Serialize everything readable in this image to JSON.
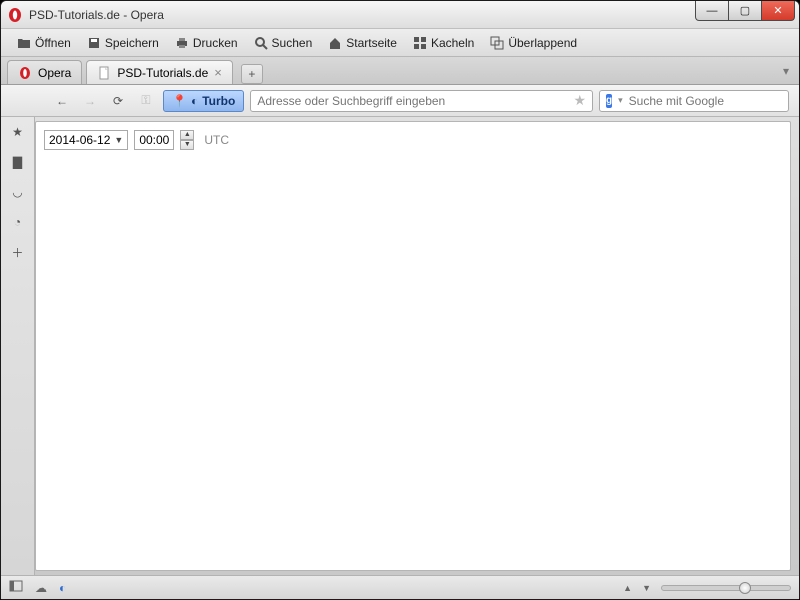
{
  "window": {
    "title": "PSD-Tutorials.de - Opera"
  },
  "menu": {
    "open": "Öffnen",
    "save": "Speichern",
    "print": "Drucken",
    "search": "Suchen",
    "home": "Startseite",
    "tile": "Kacheln",
    "cascade": "Überlappend"
  },
  "tabs": {
    "opera": "Opera",
    "active": "PSD-Tutorials.de"
  },
  "nav": {
    "turbo": "Turbo",
    "address_placeholder": "Adresse oder Suchbegriff eingeben",
    "search_placeholder": "Suche mit Google"
  },
  "page": {
    "date": "2014-06-12",
    "time": "00:00",
    "tz": "UTC"
  },
  "status": {
    "zoom_percent": 65
  }
}
